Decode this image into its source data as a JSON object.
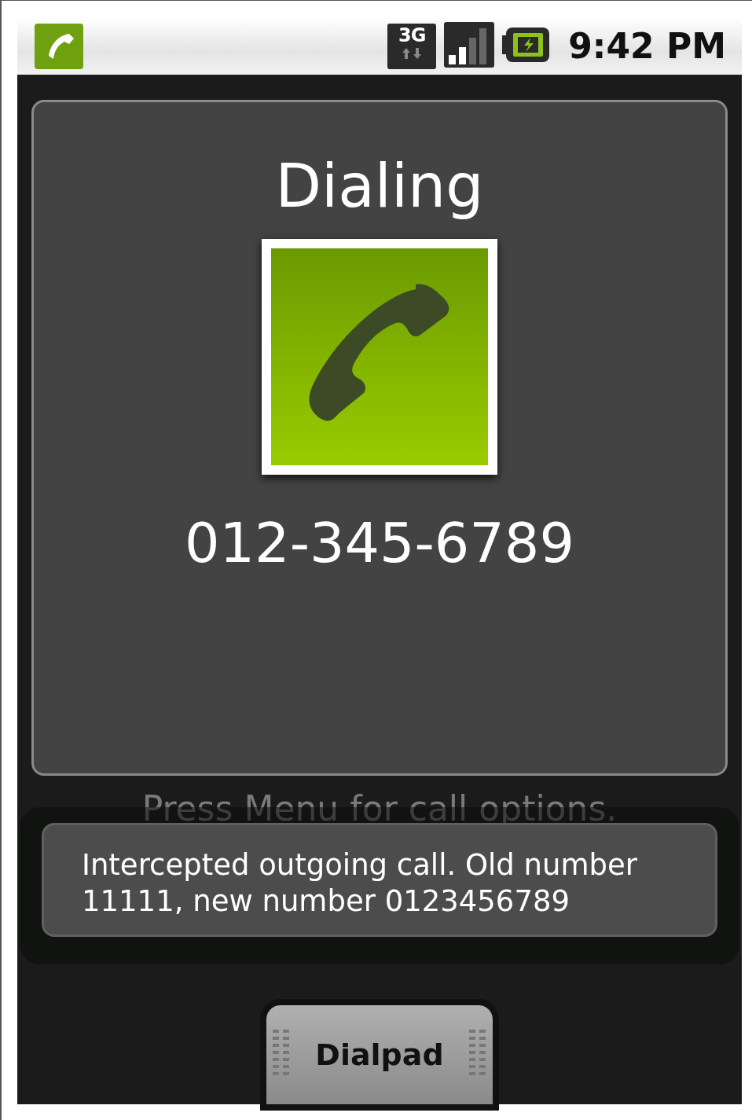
{
  "status_bar": {
    "time": "9:42 PM",
    "network_label": "3G"
  },
  "call": {
    "status": "Dialing",
    "number": "012-345-6789",
    "hint": "Press Menu for call options."
  },
  "toast": {
    "message": "Intercepted outgoing call. Old number 11111, new number 0123456789"
  },
  "tab": {
    "label": "Dialpad"
  }
}
